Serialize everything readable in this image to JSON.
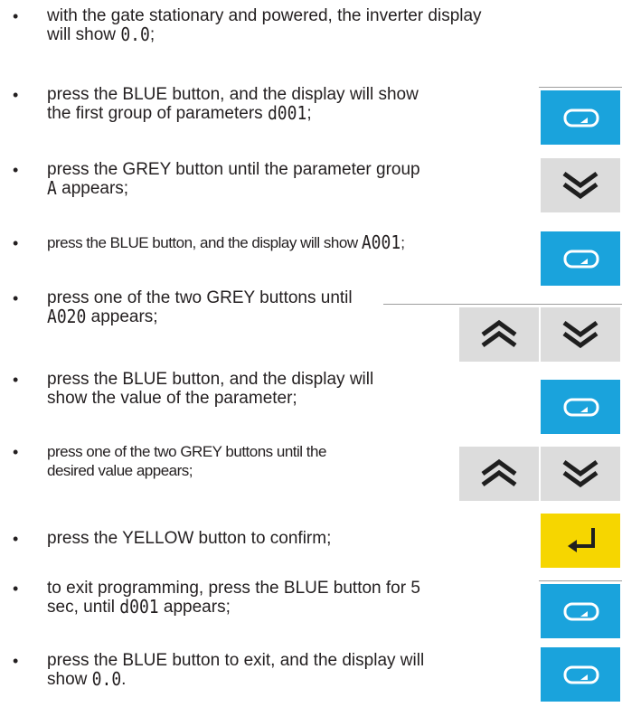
{
  "bullet": "•",
  "steps": [
    {
      "text": "with the gate stationary and powered, the inverter display",
      "text2": "will show ",
      "code": "0.0",
      "end": ";"
    },
    {
      "text": "press the BLUE button, and the display will show",
      "text2": "the first group of parameters ",
      "code": "d001",
      "end": ";"
    },
    {
      "text": "press the GREY button until the parameter group",
      "code": "A",
      "end": " appears;"
    },
    {
      "text": "press the BLUE button, and the display will show ",
      "code": "A001",
      "end": ";"
    },
    {
      "text": "press one of the two GREY buttons until",
      "code": "A020",
      "end": " appears;"
    },
    {
      "text": "press the BLUE button, and the display will",
      "text2": "show the value of the parameter;"
    },
    {
      "text": "press one of the two GREY buttons until the",
      "text2": "desired value appears;"
    },
    {
      "text": "press the YELLOW button to confirm;"
    },
    {
      "text": "to exit programming, press the BLUE button for 5",
      "text2": "sec, until ",
      "code": "d001",
      "end": " appears;"
    },
    {
      "text": "press the BLUE button to exit, and the display will",
      "text2": "show ",
      "code": "0.0",
      "end": "."
    }
  ],
  "colors": {
    "blue": "#1aa3dc",
    "grey": "#dcdcdc",
    "yellow": "#f6d600",
    "text": "#231f20"
  },
  "buttons": [
    {
      "step": 1,
      "icon": "enter-icon",
      "color": "blue"
    },
    {
      "step": 2,
      "icon": "double-chevron-down-icon",
      "color": "grey"
    },
    {
      "step": 3,
      "icon": "enter-icon",
      "color": "blue"
    },
    {
      "step": 4,
      "icons": [
        "double-chevron-up-icon",
        "double-chevron-down-icon"
      ],
      "color": "grey"
    },
    {
      "step": 5,
      "icon": "enter-icon",
      "color": "blue"
    },
    {
      "step": 6,
      "icons": [
        "double-chevron-up-icon",
        "double-chevron-down-icon"
      ],
      "color": "grey"
    },
    {
      "step": 7,
      "icon": "return-icon",
      "color": "yellow"
    },
    {
      "step": 8,
      "icon": "enter-icon",
      "color": "blue"
    },
    {
      "step": 9,
      "icon": "enter-icon",
      "color": "blue"
    }
  ]
}
